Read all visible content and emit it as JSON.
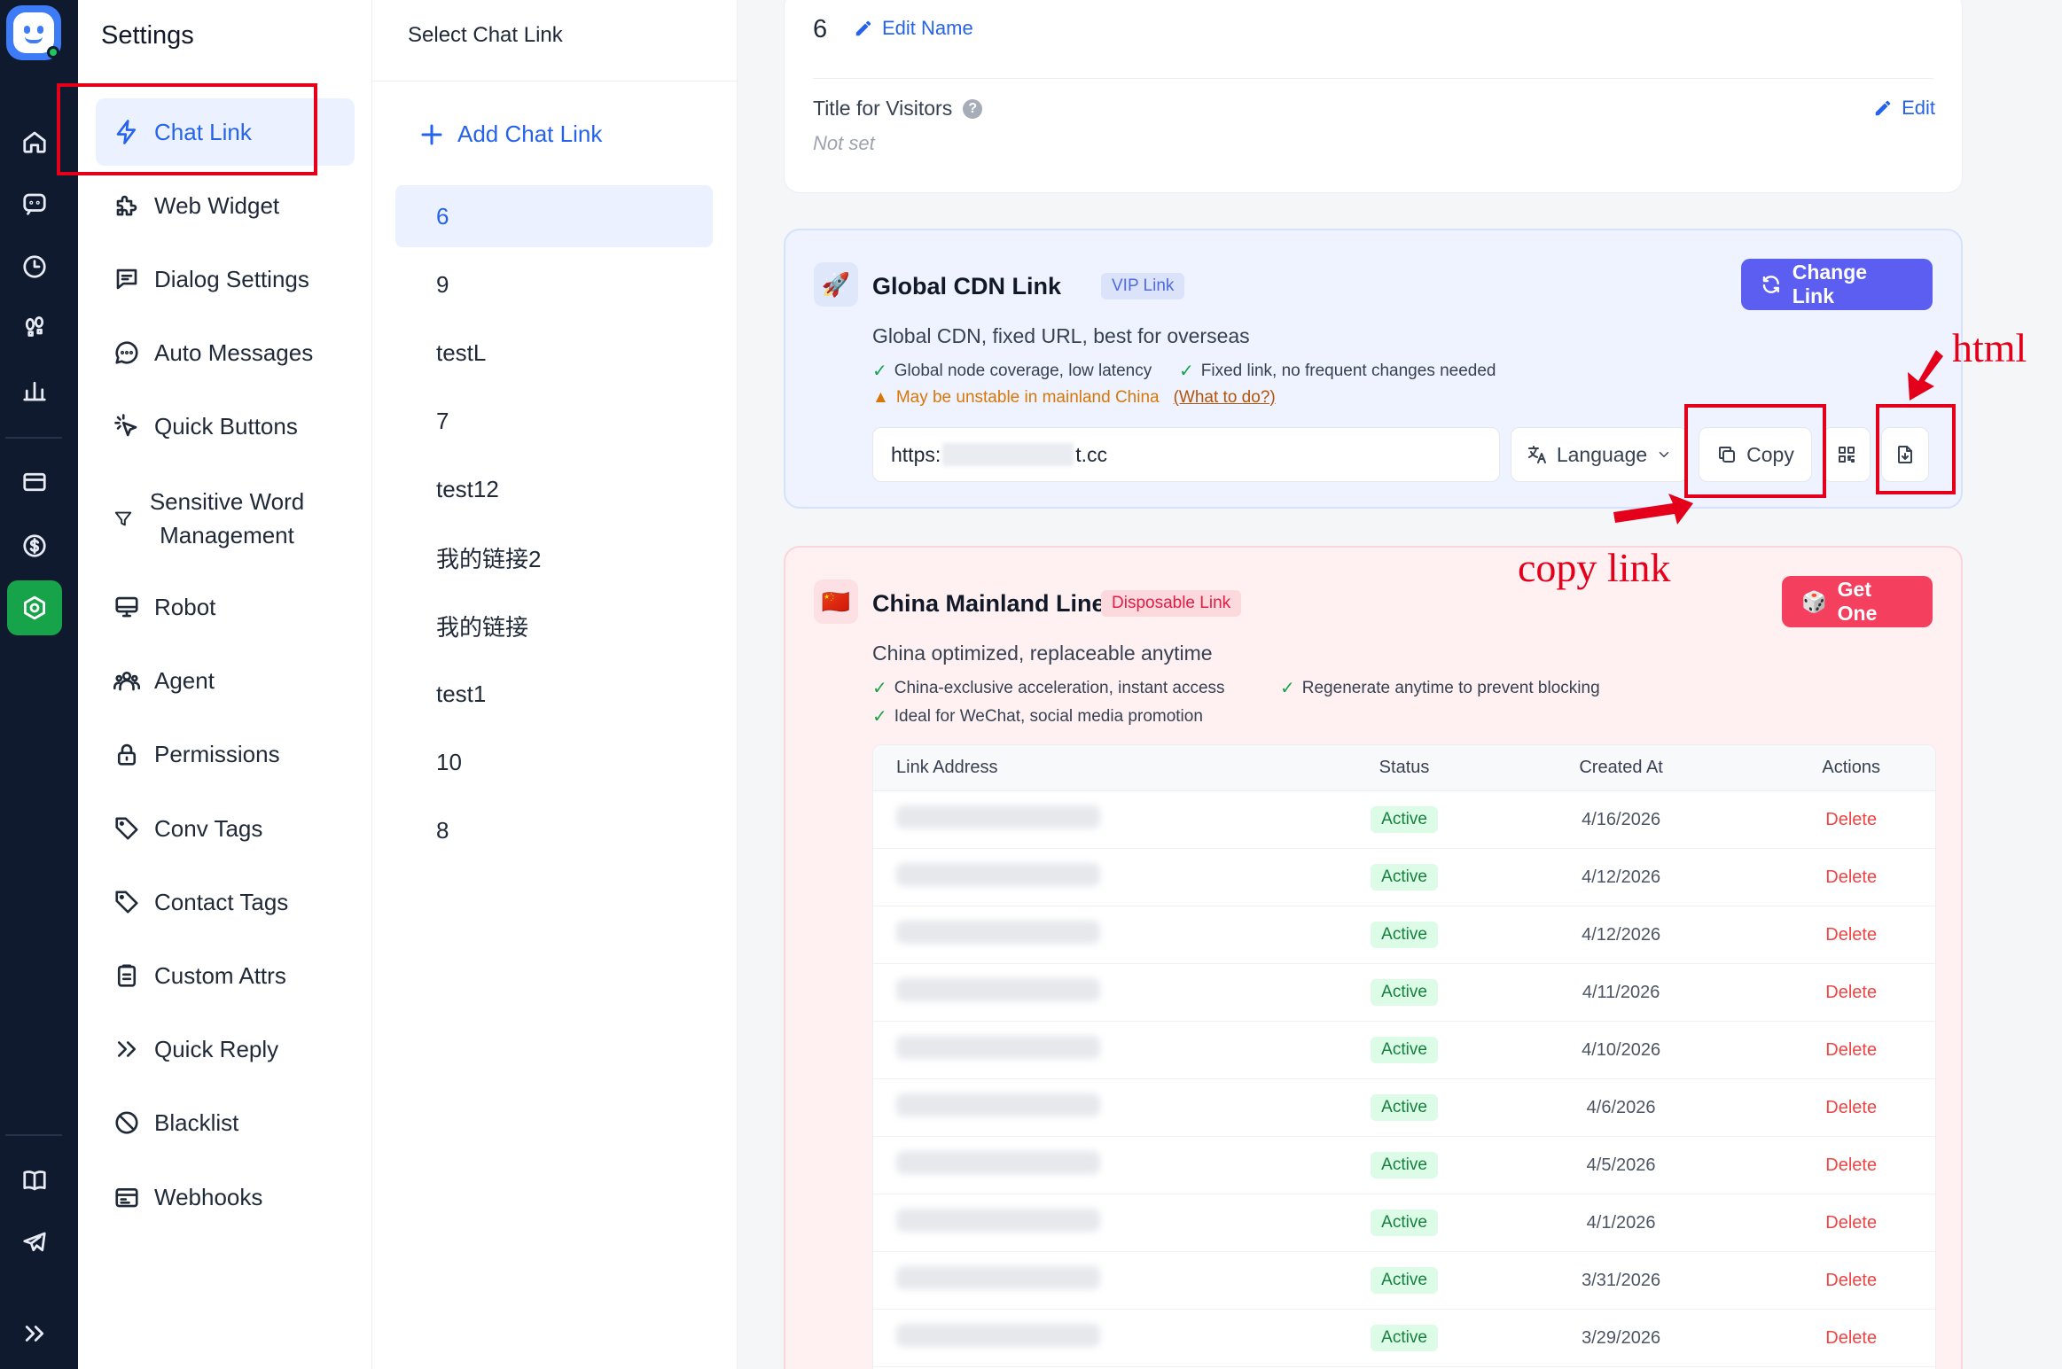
{
  "rail": {
    "items": [
      {
        "name": "home-icon"
      },
      {
        "name": "chat-bubble-icon"
      },
      {
        "name": "history-icon"
      },
      {
        "name": "footprints-icon"
      },
      {
        "name": "bar-chart-icon"
      },
      {
        "name": "card-icon"
      },
      {
        "name": "dollar-icon"
      },
      {
        "name": "settings-icon",
        "active": true
      },
      {
        "name": "book-icon"
      },
      {
        "name": "telegram-icon"
      },
      {
        "name": "expand-icon"
      }
    ]
  },
  "settings": {
    "title": "Settings",
    "items": [
      {
        "label": "Chat Link",
        "icon": "lightning-icon",
        "active": true
      },
      {
        "label": "Web Widget",
        "icon": "puzzle-icon"
      },
      {
        "label": "Dialog Settings",
        "icon": "message-square-icon"
      },
      {
        "label": "Auto Messages",
        "icon": "message-circle-icon"
      },
      {
        "label": "Quick Buttons",
        "icon": "cursor-click-icon"
      },
      {
        "label": "Sensitive Word Management",
        "icon": "filter-icon"
      },
      {
        "label": "Robot",
        "icon": "monitor-icon"
      },
      {
        "label": "Agent",
        "icon": "users-icon"
      },
      {
        "label": "Permissions",
        "icon": "lock-icon"
      },
      {
        "label": "Conv Tags",
        "icon": "tag-icon"
      },
      {
        "label": "Contact Tags",
        "icon": "tag-icon"
      },
      {
        "label": "Custom Attrs",
        "icon": "clipboard-icon"
      },
      {
        "label": "Quick Reply",
        "icon": "chevrons-right-icon"
      },
      {
        "label": "Blacklist",
        "icon": "ban-icon"
      },
      {
        "label": "Webhooks",
        "icon": "webhook-icon"
      }
    ]
  },
  "links": {
    "header": "Select Chat Link",
    "add_label": "Add Chat Link",
    "items": [
      "6",
      "9",
      "testL",
      "7",
      "test12",
      "我的链接2",
      "我的链接",
      "test1",
      "10",
      "8"
    ]
  },
  "info": {
    "name": "6",
    "edit_name": "Edit Name",
    "title_label": "Title for Visitors",
    "title_value": "Not set",
    "edit": "Edit"
  },
  "cdn": {
    "icon": "🚀",
    "title": "Global CDN Link",
    "badge": "VIP Link",
    "button": "Change Link",
    "desc": "Global CDN, fixed URL, best for overseas",
    "feature1": "Global node coverage, low latency",
    "feature2": "Fixed link, no frequent changes needed",
    "warning": "May be unstable in mainland China",
    "warning_help": "(What to do?)",
    "url_prefix": "https:",
    "url_suffix": "t.cc",
    "language": "Language",
    "copy": "Copy"
  },
  "annotations": {
    "html": "html",
    "copy_link": "copy link"
  },
  "china": {
    "icon": "🇨🇳",
    "title": "China Mainland Line",
    "badge": "Disposable Link",
    "button": "Get One",
    "desc": "China optimized, replaceable anytime",
    "feature1": "China-exclusive acceleration, instant access",
    "feature2": "Regenerate anytime to prevent blocking",
    "feature3": "Ideal for WeChat, social media promotion",
    "columns": [
      "Link Address",
      "Status",
      "Created At",
      "Actions"
    ],
    "rows": [
      {
        "status": "Active",
        "created": "4/16/2026",
        "action": "Delete"
      },
      {
        "status": "Active",
        "created": "4/12/2026",
        "action": "Delete"
      },
      {
        "status": "Active",
        "created": "4/12/2026",
        "action": "Delete"
      },
      {
        "status": "Active",
        "created": "4/11/2026",
        "action": "Delete"
      },
      {
        "status": "Active",
        "created": "4/10/2026",
        "action": "Delete"
      },
      {
        "status": "Active",
        "created": "4/6/2026",
        "action": "Delete"
      },
      {
        "status": "Active",
        "created": "4/5/2026",
        "action": "Delete"
      },
      {
        "status": "Active",
        "created": "4/1/2026",
        "action": "Delete"
      },
      {
        "status": "Active",
        "created": "3/31/2026",
        "action": "Delete"
      },
      {
        "status": "Active",
        "created": "3/29/2026",
        "action": "Delete"
      }
    ]
  },
  "colors": {
    "accent": "#2563eb",
    "rail_bg": "#101a2e",
    "rail_active": "#17a34a",
    "vip_button": "#5b5ef0",
    "danger_button": "#f43f5e",
    "annotation_red": "#e4001b"
  }
}
